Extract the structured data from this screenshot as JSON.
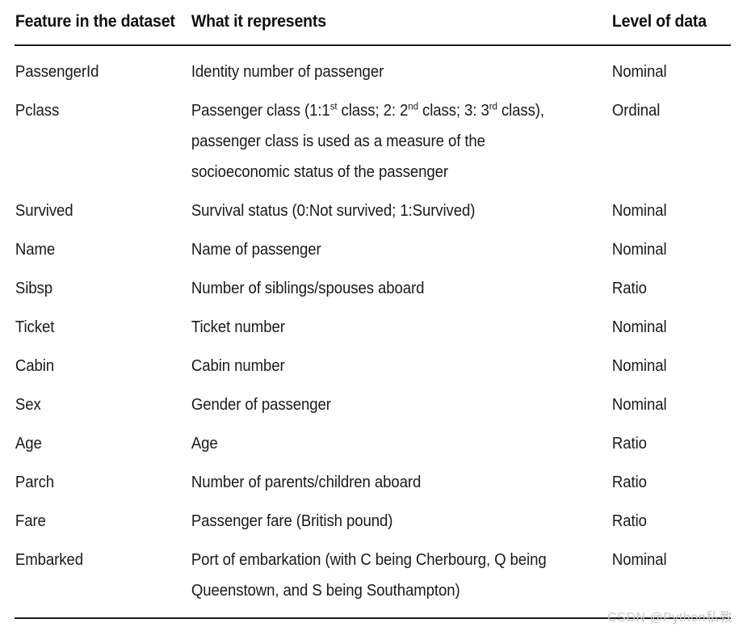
{
  "table": {
    "headers": {
      "feature": "Feature in the dataset",
      "meaning": "What it represents",
      "level": "Level of data"
    },
    "rows": [
      {
        "feature": "PassengerId",
        "meaning": "Identity number of passenger",
        "meaning_html": "Identity number of passenger",
        "level": "Nominal"
      },
      {
        "feature": "Pclass",
        "meaning": "Passenger class (1:1st class; 2: 2nd class; 3: 3rd class), passenger class is used as a measure of the socioeconomic status of the passenger",
        "meaning_html": "Passenger class (1:1<sup>st</sup> class; 2: 2<sup>nd</sup> class; 3: 3<sup>rd</sup> class), passenger class is used as a measure of the socioeconomic status of the passenger",
        "level": "Ordinal"
      },
      {
        "feature": "Survived",
        "meaning": "Survival status (0:Not survived; 1:Survived)",
        "meaning_html": "Survival status (0:Not survived; 1:Survived)",
        "level": "Nominal"
      },
      {
        "feature": "Name",
        "meaning": "Name of passenger",
        "meaning_html": "Name of passenger",
        "level": "Nominal"
      },
      {
        "feature": "Sibsp",
        "meaning": "Number of siblings/spouses aboard",
        "meaning_html": "Number of siblings/spouses aboard",
        "level": "Ratio"
      },
      {
        "feature": "Ticket",
        "meaning": "Ticket number",
        "meaning_html": "Ticket number",
        "level": "Nominal"
      },
      {
        "feature": "Cabin",
        "meaning": "Cabin number",
        "meaning_html": "Cabin number",
        "level": "Nominal"
      },
      {
        "feature": "Sex",
        "meaning": "Gender of passenger",
        "meaning_html": "Gender of passenger",
        "level": "Nominal"
      },
      {
        "feature": "Age",
        "meaning": "Age",
        "meaning_html": "Age",
        "level": "Ratio"
      },
      {
        "feature": "Parch",
        "meaning": "Number of parents/children aboard",
        "meaning_html": "Number of parents/children aboard",
        "level": "Ratio"
      },
      {
        "feature": "Fare",
        "meaning": "Passenger fare (British pound)",
        "meaning_html": "Passenger fare (British pound)",
        "level": "Ratio"
      },
      {
        "feature": "Embarked",
        "meaning": "Port of embarkation (with C being Cherbourg, Q being Queenstown, and S being Southampton)",
        "meaning_html": "Port of embarkation (with C being Cherbourg, Q being Queenstown, and S being Southampton)",
        "level": "Nominal"
      }
    ]
  },
  "watermark": {
    "text": "CSDN @Python私教"
  },
  "colors": {
    "text": "#1a1a1a",
    "rule": "#1a1a1a",
    "background": "#ffffff",
    "watermark": "#c9c9c9"
  }
}
